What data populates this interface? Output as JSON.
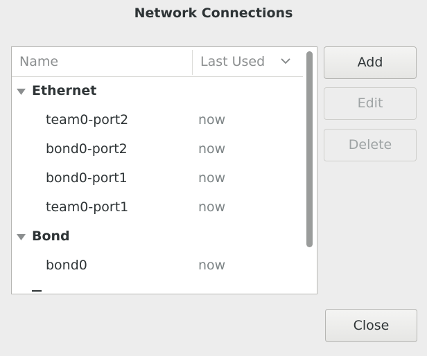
{
  "window": {
    "title": "Network Connections"
  },
  "list": {
    "columns": {
      "name": "Name",
      "last_used": "Last Used"
    },
    "groups": [
      {
        "label": "Ethernet",
        "expanded": true,
        "connections": [
          {
            "name": "team0-port2",
            "last_used": "now"
          },
          {
            "name": "bond0-port2",
            "last_used": "now"
          },
          {
            "name": "bond0-port1",
            "last_used": "now"
          },
          {
            "name": "team0-port1",
            "last_used": "now"
          }
        ]
      },
      {
        "label": "Bond",
        "expanded": true,
        "connections": [
          {
            "name": "bond0",
            "last_used": "now"
          }
        ]
      }
    ]
  },
  "buttons": {
    "add": "Add",
    "edit": "Edit",
    "delete": "Delete",
    "close": "Close"
  },
  "colors": {
    "window_bg": "#ededed",
    "list_bg": "#ffffff",
    "text": "#2e3436",
    "muted_text": "#7e8587",
    "scrollbar_thumb": "#9a9c9b"
  },
  "icons": {
    "sort": "chevron-down-icon",
    "expander": "triangle-down-icon"
  }
}
